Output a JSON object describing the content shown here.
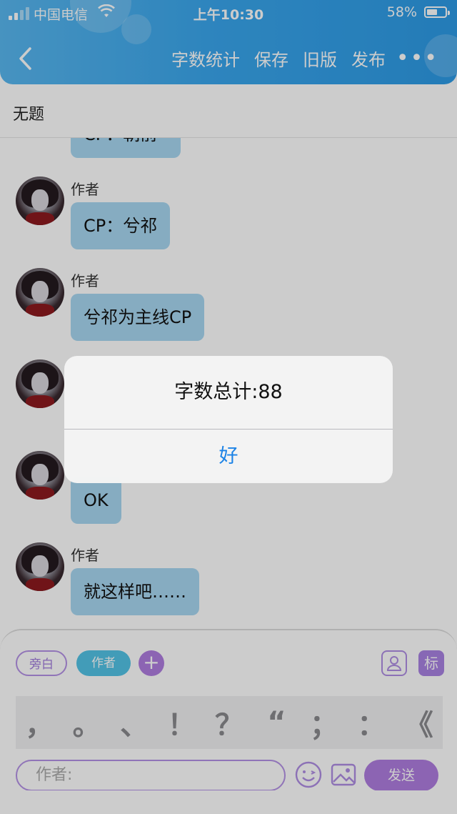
{
  "status_bar": {
    "carrier": "中国电信",
    "time": "上午10:30",
    "battery": "58%"
  },
  "header": {
    "actions": [
      "字数统计",
      "保存",
      "旧版",
      "发布"
    ],
    "more": "•••"
  },
  "doc": {
    "title": "无题"
  },
  "messages": [
    {
      "author": "",
      "text": "CP：朝前",
      "partial": true
    },
    {
      "author": "作者",
      "text": "CP：兮祁"
    },
    {
      "author": "作者",
      "text": "兮祁为主线CP"
    },
    {
      "author": "",
      "text": ""
    },
    {
      "author": "",
      "text": "OK"
    },
    {
      "author": "作者",
      "text": "就这样吧……"
    }
  ],
  "composer": {
    "roles": {
      "narration": "旁白",
      "author": "作者",
      "add": "+"
    },
    "tag_button": "标",
    "punctuation": [
      "，",
      "。",
      "、",
      "！",
      "？",
      "“",
      "；",
      "：",
      "《"
    ],
    "input_placeholder": "作者:",
    "send": "发送"
  },
  "dialog": {
    "message": "字数总计:88",
    "ok": "好"
  },
  "colors": {
    "header": "#3aa7ee",
    "bubble": "#a8d8f2",
    "accent_purple": "#b07ee0",
    "dialog_button": "#1b82e6"
  }
}
